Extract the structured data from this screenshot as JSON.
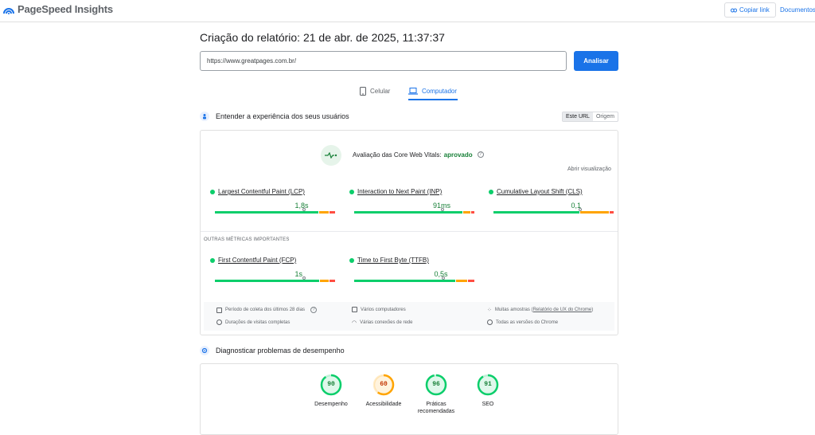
{
  "header": {
    "app_title": "PageSpeed Insights",
    "copy_link": "Copiar link",
    "docs": "Documentos"
  },
  "report": {
    "title": "Criação do relatório: 21 de abr. de 2025, 11:37:37",
    "url_value": "https://www.greatpages.com.br/",
    "analyze_label": "Analisar"
  },
  "tabs": [
    {
      "label": "Celular",
      "active": false
    },
    {
      "label": "Computador",
      "active": true
    }
  ],
  "section1": {
    "title": "Entender a experiência dos seus usuários",
    "toggle": [
      "Este URL",
      "Origem"
    ]
  },
  "cwv": {
    "label": "Avaliação das Core Web Vitals:",
    "status": "aprovado",
    "expand": "Abrir visualização",
    "metrics": [
      {
        "name": "Largest Contentful Paint (LCP)",
        "value": "1,8s",
        "good": 0.86,
        "ok": 0.09,
        "poor": 0.05,
        "marker": 0.74
      },
      {
        "name": "Interaction to Next Paint (INP)",
        "value": "91ms",
        "good": 0.9,
        "ok": 0.07,
        "poor": 0.03,
        "marker": 0.73
      },
      {
        "name": "Cumulative Layout Shift (CLS)",
        "value": "0,1",
        "good": 0.72,
        "ok": 0.24,
        "poor": 0.04,
        "marker": 0.72
      }
    ],
    "other_label": "OUTRAS MÉTRICAS IMPORTANTES",
    "other_metrics": [
      {
        "name": "First Contentful Paint (FCP)",
        "value": "1s",
        "good": 0.87,
        "ok": 0.08,
        "poor": 0.05,
        "marker": 0.74
      },
      {
        "name": "Time to First Byte (TTFB)",
        "value": "0,5s",
        "good": 0.84,
        "ok": 0.1,
        "poor": 0.06,
        "marker": 0.74
      }
    ],
    "info": {
      "period": "Período de coleta dos últimos 28 dias",
      "durations": "Durações de visitas completas",
      "computers": "Vários computadores",
      "networks": "Várias conexões de rede",
      "samples": "Muitas amostras (",
      "samples_link": "Relatório de UX do Chrome",
      "samples_end": ")",
      "chrome": "Todas as versões do Chrome"
    }
  },
  "section2": {
    "title": "Diagnosticar problemas de desempenho",
    "scores": [
      {
        "value": 90,
        "label": "Desempenho",
        "color": "#0cce6b",
        "text": "#188038"
      },
      {
        "value": 60,
        "label": "Acessibilidade",
        "color": "#ffa400",
        "text": "#c33300"
      },
      {
        "value": 96,
        "label": "Práticas recomendadas",
        "color": "#0cce6b",
        "text": "#188038"
      },
      {
        "value": 91,
        "label": "SEO",
        "color": "#0cce6b",
        "text": "#188038"
      }
    ]
  }
}
